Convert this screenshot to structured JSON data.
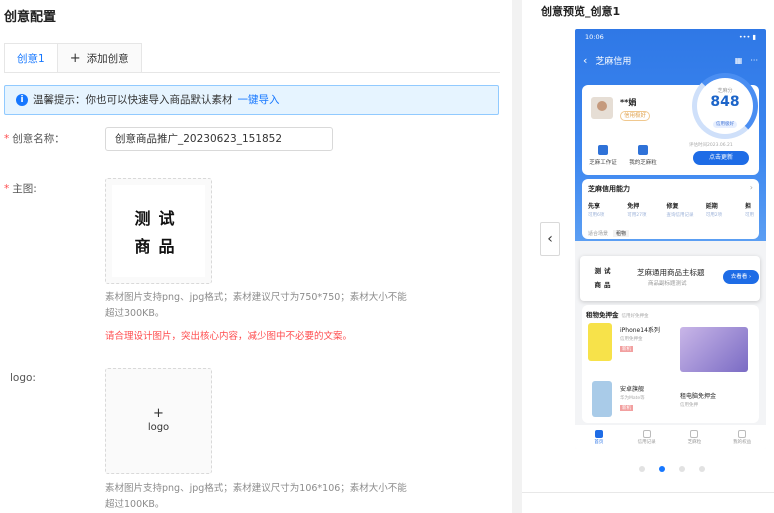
{
  "left": {
    "title": "创意配置",
    "tabs": [
      {
        "label": "创意1",
        "active": true
      },
      {
        "label": "添加创意",
        "icon": "plus-icon"
      }
    ],
    "tip": {
      "text": "温馨提示：你也可以快速导入商品默认素材",
      "link": "一键导入"
    },
    "name_field": {
      "label": "创意名称：",
      "value": "创意商品推广_20230623_151852"
    },
    "main_image": {
      "label": "主图:",
      "preview_lines": [
        "测试",
        "商品"
      ],
      "hint": "素材图片支持png、jpg格式；素材建议尺寸为750*750；素材大小不能超过300KB。",
      "warning": "请合理设计图片，突出核心内容，减少图中不必要的文案。"
    },
    "logo": {
      "label": "logo:",
      "upload_text": "logo",
      "plus": "+",
      "hint": "素材图片支持png、jpg格式；素材建议尺寸为106*106；素材大小不能超过100KB。"
    }
  },
  "preview": {
    "title": "创意预览_创意1",
    "carousel": {
      "pages": 4,
      "active_index": 1
    },
    "phone": {
      "status_time": "10:06",
      "status_right": "••• ▮",
      "nav_title": "芝麻信用",
      "user_name": "**娟",
      "user_badge": "信用极好",
      "score_label": "芝麻分",
      "score": "848",
      "score_pill": "信用极好",
      "score_date": "评估时间2023.06.21",
      "quick_actions": [
        "芝麻工作证",
        "我的芝麻粒"
      ],
      "update_button": "点击更新",
      "ability_title": "芝麻信用能力",
      "abilities": [
        {
          "name": "先享",
          "sub": "可用6项"
        },
        {
          "name": "免押",
          "sub": "可用27项"
        },
        {
          "name": "修复",
          "sub": "查询信用记录"
        },
        {
          "name": "延期",
          "sub": "可用2项"
        },
        {
          "name": "担",
          "sub": "可用"
        }
      ],
      "ability_tags_label": "适合场景",
      "ability_tag": "租物",
      "ad": {
        "image_lines": [
          "测试",
          "商品"
        ],
        "title": "芝麻通用商品主标题",
        "subtitle": "商品副标题测试",
        "button": "去看看 ›"
      },
      "rent_title": "租物免押金",
      "rent_subtitle": "信用好免押金",
      "products": [
        {
          "name": "iPhone14系列",
          "desc": "信用免押金",
          "tag": "新机"
        },
        {
          "name": "",
          "desc": ""
        },
        {
          "name": "安卓旗舰",
          "desc": "华为Mate等",
          "tag": "新机"
        },
        {
          "name": "租电脑免押金",
          "desc": "信用免押"
        }
      ],
      "tabbar": [
        "首页",
        "信用记录",
        "芝麻粒",
        "我的权益"
      ]
    }
  }
}
